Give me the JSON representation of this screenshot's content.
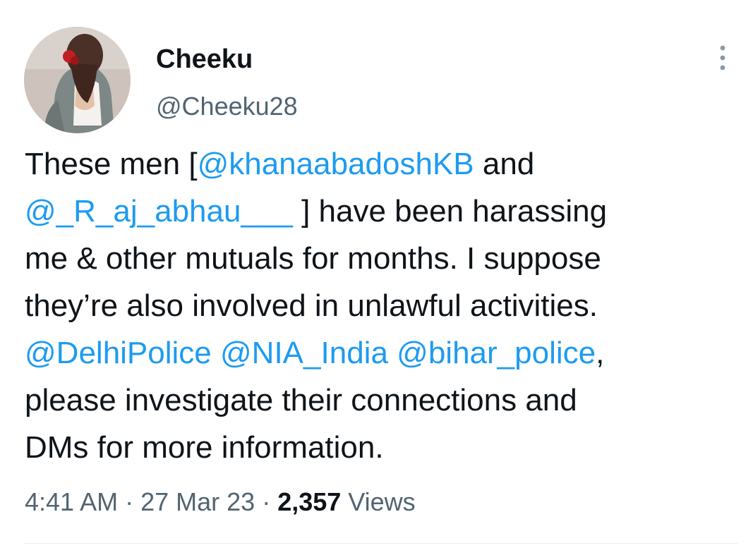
{
  "author": {
    "display_name": "Cheeku",
    "handle": "@Cheeku28"
  },
  "tweet": {
    "lines": [
      [
        {
          "text": "These men [",
          "type": "text"
        },
        {
          "text": "@khanaabadoshKB",
          "type": "mention"
        },
        {
          "text": " and",
          "type": "text"
        }
      ],
      [
        {
          "text": "@_R_aj_abhau___",
          "type": "mention"
        },
        {
          "text": " ] have been harassing",
          "type": "text"
        }
      ],
      [
        {
          "text": "me & other mutuals for months. I suppose",
          "type": "text"
        }
      ],
      [
        {
          "text": "they’re also involved in unlawful activities.",
          "type": "text"
        }
      ],
      [
        {
          "text": "@DelhiPolice",
          "type": "mention"
        },
        {
          "text": " ",
          "type": "text"
        },
        {
          "text": "@NIA_India",
          "type": "mention"
        },
        {
          "text": " ",
          "type": "text"
        },
        {
          "text": "@bihar_police",
          "type": "mention"
        },
        {
          "text": ",",
          "type": "text"
        }
      ],
      [
        {
          "text": "please investigate their connections and",
          "type": "text"
        }
      ],
      [
        {
          "text": "DMs for more information.",
          "type": "text"
        }
      ]
    ]
  },
  "meta": {
    "time": "4:41 AM",
    "separator": " · ",
    "date": "27 Mar 23",
    "views_count": "2,357",
    "views_label": " Views"
  },
  "icons": {
    "more": "more-vertical-icon",
    "avatar": "profile-photo"
  },
  "colors": {
    "text": "#0f1419",
    "secondary": "#536471",
    "mention": "#1d9bf0",
    "more_icon": "#8b98a5",
    "divider": "#e6ecf0"
  }
}
